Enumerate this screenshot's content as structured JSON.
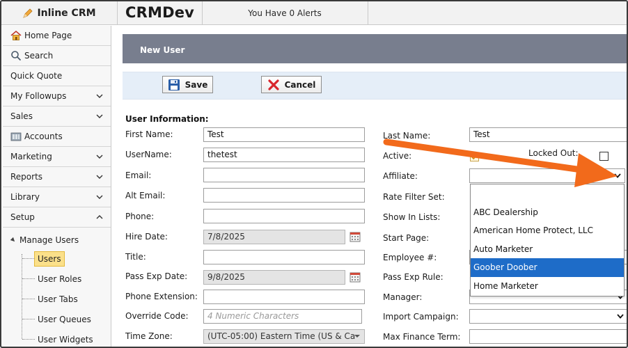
{
  "app": {
    "brand": "Inline CRM",
    "environment": "CRMDev",
    "alerts": "You Have 0 Alerts"
  },
  "sidebar": {
    "items": [
      {
        "label": "Home Page",
        "icon": "home-icon"
      },
      {
        "label": "Search",
        "icon": "search-icon"
      },
      {
        "label": "Quick Quote"
      },
      {
        "label": "My Followups",
        "icon": "chevron-down-icon"
      },
      {
        "label": "Sales",
        "icon": "chevron-down-icon"
      },
      {
        "label": "Accounts",
        "icon": "accounts-icon"
      },
      {
        "label": "Marketing",
        "icon": "chevron-down-icon"
      },
      {
        "label": "Reports",
        "icon": "chevron-down-icon"
      },
      {
        "label": "Library",
        "icon": "chevron-down-icon"
      },
      {
        "label": "Setup",
        "icon": "chevron-up-icon"
      }
    ],
    "tree": {
      "head": "Manage Users",
      "items": [
        "Users",
        "User Roles",
        "User Tabs",
        "User Queues",
        "User Widgets"
      ],
      "selected": "Users"
    }
  },
  "panel": {
    "title": "New User"
  },
  "toolbar": {
    "save_label": "Save",
    "cancel_label": "Cancel"
  },
  "form": {
    "section_title": "User Information:",
    "first_name": {
      "label": "First Name:",
      "value": "Test"
    },
    "username": {
      "label": "UserName:",
      "value": "thetest"
    },
    "email": {
      "label": "Email:",
      "value": ""
    },
    "alt_email": {
      "label": "Alt Email:",
      "value": ""
    },
    "phone": {
      "label": "Phone:",
      "value": ""
    },
    "hire_date": {
      "label": "Hire Date:",
      "value": "7/8/2025"
    },
    "title": {
      "label": "Title:",
      "value": ""
    },
    "pass_exp_date": {
      "label": "Pass Exp Date:",
      "value": "9/8/2025"
    },
    "phone_extension": {
      "label": "Phone Extension:",
      "value": ""
    },
    "override_code": {
      "label": "Override Code:",
      "placeholder": "4 Numeric Characters"
    },
    "time_zone": {
      "label": "Time Zone:",
      "value": "(UTC-05:00) Eastern Time (US & Ca"
    },
    "last_name": {
      "label": "Last Name:",
      "value": "Test"
    },
    "active": {
      "label": "Active:",
      "checked": true
    },
    "locked_out": {
      "label": "Locked Out:",
      "checked": false
    },
    "affiliate": {
      "label": "Affiliate:",
      "value": ""
    },
    "rate_filter_set": {
      "label": "Rate Filter Set:"
    },
    "show_in_lists": {
      "label": "Show In Lists:"
    },
    "start_page": {
      "label": "Start Page:"
    },
    "employee_no": {
      "label": "Employee #:"
    },
    "pass_exp_rule": {
      "label": "Pass Exp Rule:"
    },
    "manager": {
      "label": "Manager:"
    },
    "import_campaign": {
      "label": "Import Campaign:",
      "value": ""
    },
    "max_finance_term": {
      "label": "Max Finance Term:",
      "value": ""
    }
  },
  "affiliate_dropdown": {
    "options": [
      "",
      "ABC Dealership",
      "American Home Protect, LLC",
      "Auto Marketer",
      "Goober Doober",
      "Home Marketer"
    ],
    "highlighted": "Goober Doober"
  },
  "colors": {
    "panel_header": "#787e8e",
    "toolbar_bg": "#e5eef8",
    "selected_nav": "#fbe08a",
    "highlight": "#1e6cc8",
    "annotation_arrow": "#f26a1b"
  }
}
